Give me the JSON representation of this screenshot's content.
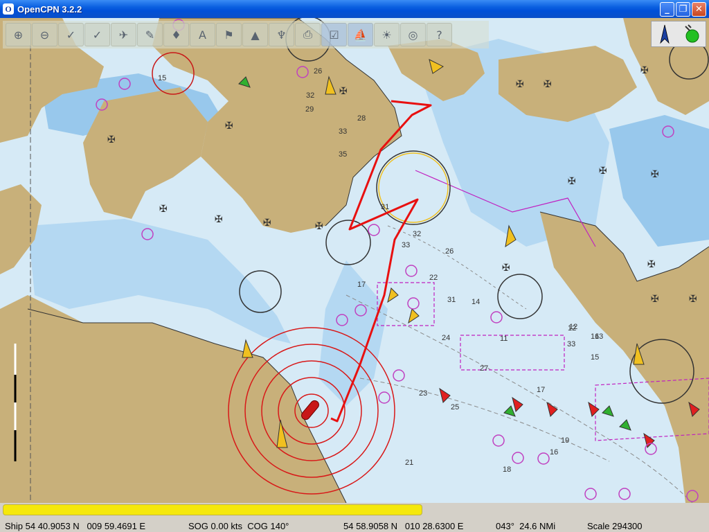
{
  "window": {
    "title": "OpenCPN 3.2.2",
    "icon_label": "O",
    "minimize": "_",
    "maximize": "❐",
    "close": "✕"
  },
  "toolbar": {
    "buttons": [
      {
        "name": "zoom-in-icon",
        "glyph": "⊕"
      },
      {
        "name": "zoom-out-icon",
        "glyph": "⊖"
      },
      {
        "name": "scale-in-icon",
        "glyph": "✓"
      },
      {
        "name": "scale-out-icon",
        "glyph": "✓"
      },
      {
        "name": "route-icon",
        "glyph": "✈"
      },
      {
        "name": "pen-icon",
        "glyph": "✎"
      },
      {
        "name": "track-icon",
        "glyph": "♦"
      },
      {
        "name": "text-icon",
        "glyph": "A"
      },
      {
        "name": "mark-icon",
        "glyph": "⚑"
      },
      {
        "name": "ais-icon",
        "glyph": "▲"
      },
      {
        "name": "tide-icon",
        "glyph": "♆"
      },
      {
        "name": "print-icon",
        "glyph": "⎙"
      },
      {
        "name": "route-manager-icon",
        "glyph": "☑"
      },
      {
        "name": "ship-icon",
        "glyph": "⛵"
      },
      {
        "name": "day-night-icon",
        "glyph": "☀"
      },
      {
        "name": "lifebuoy-icon",
        "glyph": "◎"
      },
      {
        "name": "help-icon",
        "glyph": "?"
      }
    ]
  },
  "compass_icons": [
    "compass-icon",
    "gps-status-icon"
  ],
  "status": {
    "ship": "Ship 54 40.9053 N   009 59.4691 E",
    "sog": "SOG 0.00 kts  COG 140°",
    "cursor": "54 58.9058 N   010 28.6300 E",
    "bearing": "043°  24.6 NMi",
    "scale": "Scale 294300"
  },
  "chart_labels": [
    "33",
    "35",
    "31",
    "32",
    "33",
    "26",
    "22",
    "31",
    "16",
    "33",
    "12",
    "15",
    "13",
    "23",
    "24",
    "25",
    "27",
    "17",
    "19",
    "18",
    "21",
    "28",
    "32",
    "29",
    "15",
    "11",
    "12",
    "17",
    "16",
    "14",
    "26"
  ],
  "colors": {
    "water_deep": "#d6eaf6",
    "water_shallow": "#98c8ec",
    "water_mid": "#b4d8f2",
    "land": "#c8b07a",
    "route": "#e81010",
    "range_rings": "#d81818",
    "progress": "#f5e80c"
  }
}
